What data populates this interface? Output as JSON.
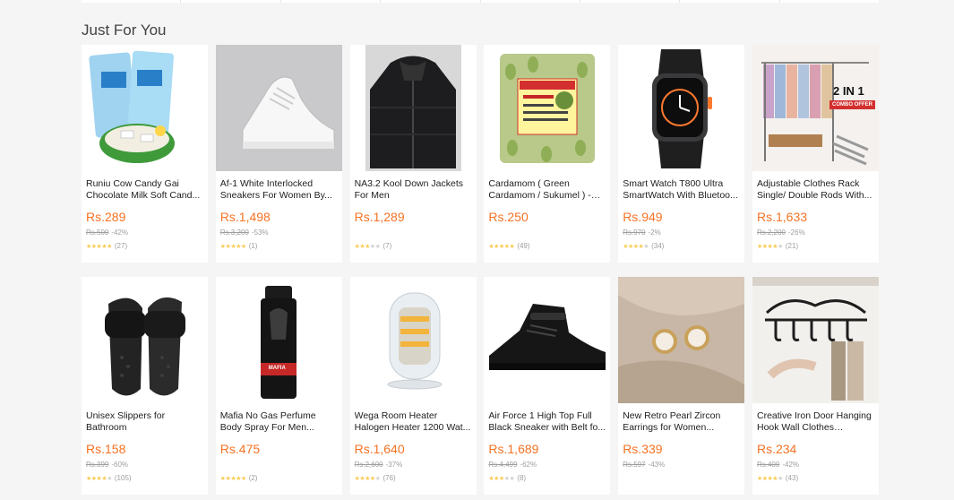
{
  "section_title": "Just For You",
  "products": [
    {
      "title": "Runiu Cow Candy Gai Chocolate Milk Soft Cand...",
      "price": "Rs.289",
      "old_price": "Rs.500",
      "discount": "-42%",
      "stars": "★★★★★",
      "stars_off": "",
      "reviews": "(27)",
      "icon": "candy-pack-icon"
    },
    {
      "title": "Af-1 White Interlocked Sneakers For Women By...",
      "price": "Rs.1,498",
      "old_price": "Rs.3,200",
      "discount": "-53%",
      "stars": "★★★★★",
      "stars_off": "",
      "reviews": "(1)",
      "icon": "white-sneaker-icon"
    },
    {
      "title": "NA3.2 Kool Down Jackets For Men",
      "price": "Rs.1,289",
      "old_price": "",
      "discount": "",
      "stars": "★★★",
      "stars_off": "★★",
      "reviews": "(7)",
      "icon": "black-jacket-icon"
    },
    {
      "title": "Cardamom ( Green Cardamom / Sukumel ) - 5...",
      "price": "Rs.250",
      "old_price": "",
      "discount": "",
      "stars": "★★★★★",
      "stars_off": "",
      "reviews": "(49)",
      "icon": "cardamom-pack-icon"
    },
    {
      "title": "Smart Watch T800 Ultra SmartWatch With Bluetoo...",
      "price": "Rs.949",
      "old_price": "Rs.970",
      "discount": "-2%",
      "stars": "★★★★",
      "stars_off": "★",
      "reviews": "(34)",
      "icon": "smartwatch-icon"
    },
    {
      "title": "Adjustable Clothes Rack Single/ Double Rods With...",
      "price": "Rs.1,633",
      "old_price": "Rs.2,200",
      "discount": "-26%",
      "stars": "★★★★",
      "stars_off": "★",
      "reviews": "(21)",
      "icon": "clothes-rack-icon",
      "badge1": "2 IN 1",
      "badge2": "COMBO OFFER"
    },
    {
      "title": "Unisex Slippers for Bathroom",
      "price": "Rs.158",
      "old_price": "Rs.399",
      "discount": "-60%",
      "stars": "★★★★",
      "stars_off": "★",
      "reviews": "(105)",
      "icon": "slipper-icon"
    },
    {
      "title": "Mafia No Gas Perfume Body Spray For Men...",
      "price": "Rs.475",
      "old_price": "",
      "discount": "",
      "stars": "★★★★★",
      "stars_off": "",
      "reviews": "(2)",
      "icon": "perfume-bottle-icon",
      "label": "MAFIA"
    },
    {
      "title": "Wega Room Heater Halogen Heater 1200 Wat...",
      "price": "Rs.1,640",
      "old_price": "Rs.2,600",
      "discount": "-37%",
      "stars": "★★★★",
      "stars_off": "★",
      "reviews": "(76)",
      "icon": "room-heater-icon"
    },
    {
      "title": "Air Force 1 High Top Full Black Sneaker with Belt fo...",
      "price": "Rs.1,689",
      "old_price": "Rs.4,499",
      "discount": "-62%",
      "stars": "★★★",
      "stars_off": "★★",
      "reviews": "(8)",
      "icon": "black-sneaker-icon"
    },
    {
      "title": "New Retro Pearl Zircon Earrings for Women...",
      "price": "Rs.339",
      "old_price": "Rs.597",
      "discount": "-43%",
      "stars": "",
      "stars_off": "",
      "reviews": "",
      "icon": "pearl-earrings-icon"
    },
    {
      "title": "Creative Iron Door Hanging Hook Wall Clothes Hanger...",
      "price": "Rs.234",
      "old_price": "Rs.400",
      "discount": "-42%",
      "stars": "★★★★",
      "stars_off": "★",
      "reviews": "(43)",
      "icon": "door-hook-hanger-icon"
    }
  ]
}
